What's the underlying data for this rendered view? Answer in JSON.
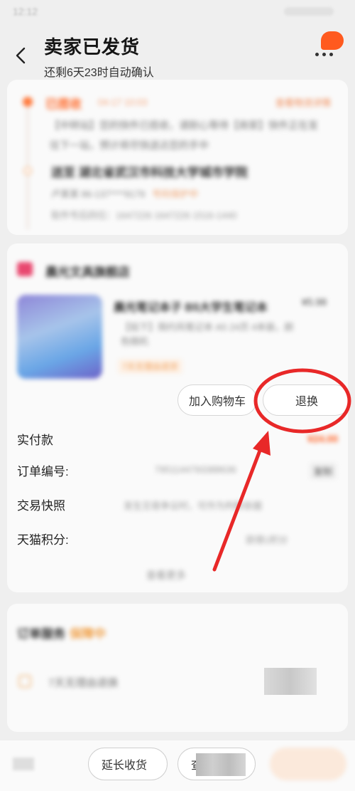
{
  "status_bar": {
    "time": "12:12"
  },
  "header": {
    "title": "卖家已发货",
    "subtitle": "还剩6天23时自动确认"
  },
  "logistics": {
    "status": "已揽收",
    "time": "04-17 10:03",
    "action": "查看物流详情",
    "detail": "【中转站】您的快件已揽收，请耐心等待【商家】快件正在发往下一站，预计将尽快送达您的手中",
    "address": "送至 湖北省武汉市科技大学城市学院",
    "contact": "卢某某 86-137****9179",
    "contact_tag": "号码保护中",
    "extra": "取件号后四位：1647226",
    "extra_code": "1647226 1516-1440"
  },
  "order": {
    "shop_name": "晨光文具旗舰店",
    "product_title": "晨光笔记本子 B5大学生笔记本",
    "product_price": "¥5.98",
    "product_sku": "【拍下】简约风笔记本 A5 24页 4本装，颜色随机",
    "product_tag": "7天无理由退货",
    "cart_button": "加入购物车",
    "return_button": "退换",
    "rows": {
      "paid_label": "实付款",
      "paid_value": "¥24.00",
      "order_no_label": "订单编号:",
      "order_no_value": "7951144793388636",
      "copy_label": "复制",
      "snapshot_label": "交易快照",
      "snapshot_value": "发生交易争议时，可作为判断依据",
      "points_label": "天猫积分:",
      "points_value": "获得1积分"
    },
    "view_more": "查看更多"
  },
  "service": {
    "title": "订单服务",
    "title_highlight": "保障中",
    "item_label": "7天无理由退换"
  },
  "bottom_bar": {
    "extend_button": "延长收货",
    "view_button": "查看物流"
  },
  "colors": {
    "accent": "#ff5a1f",
    "annotation_red": "#e82828"
  }
}
